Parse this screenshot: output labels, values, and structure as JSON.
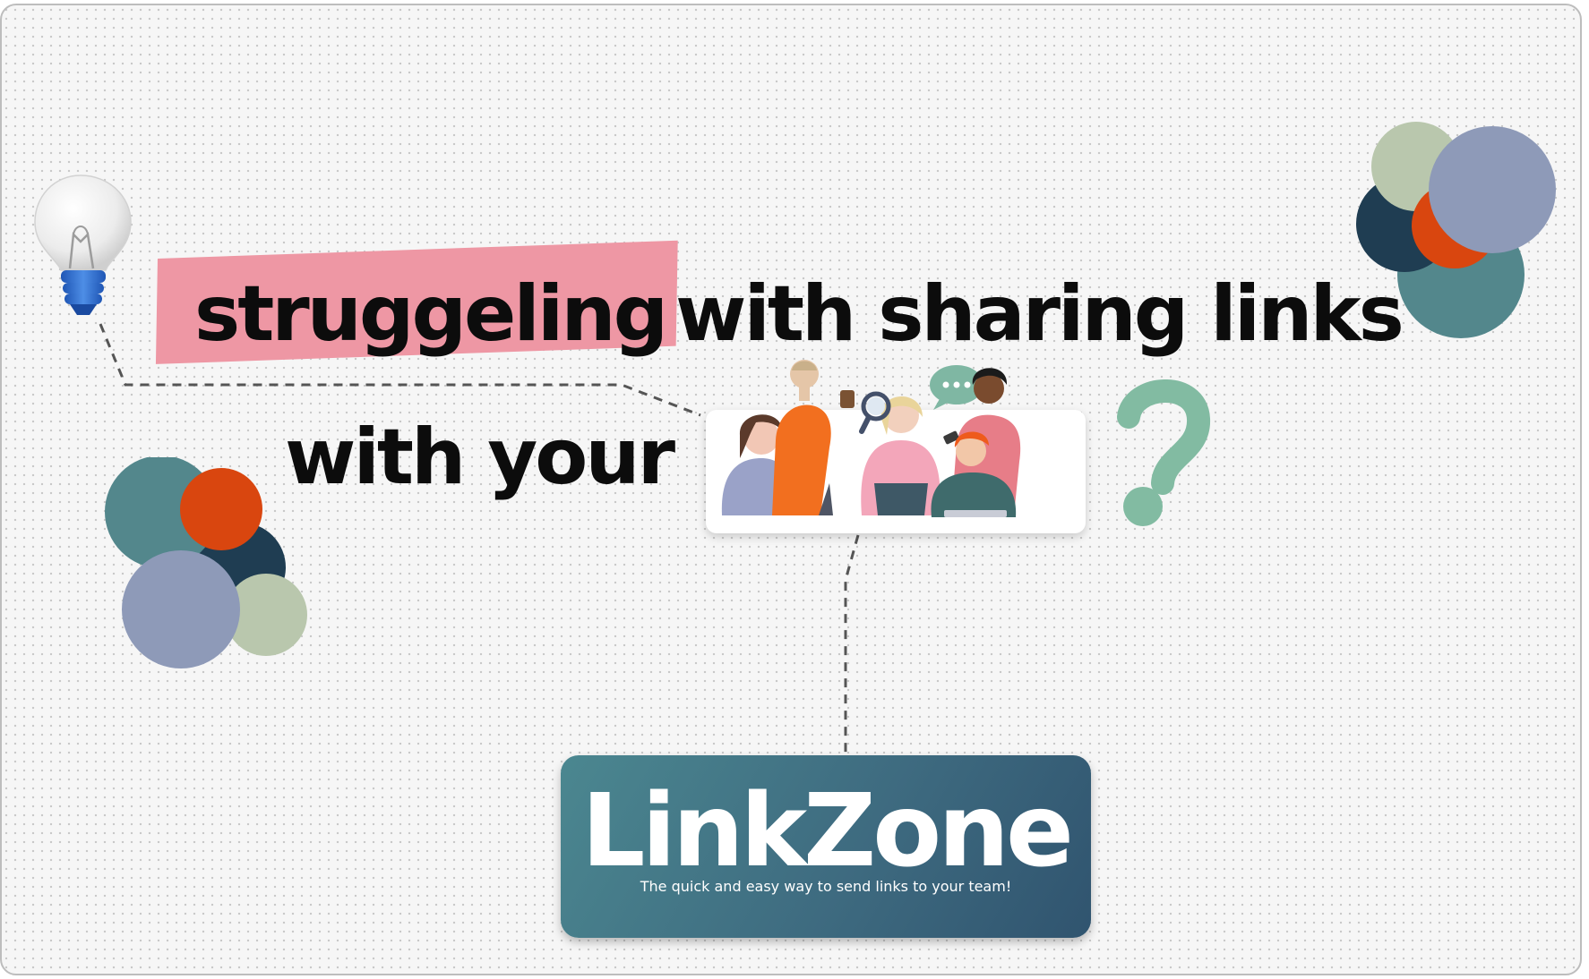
{
  "headline": {
    "highlighted": "struggeling",
    "rest_line1": "with sharing links",
    "line2": "with your"
  },
  "logo": {
    "name": "LinkZone",
    "tagline": "The quick and easy way to send links to your team!"
  },
  "icons": [
    "lightbulb-icon",
    "question-mark-icon",
    "team-illustration"
  ],
  "colors": {
    "highlight": "#ee97a4",
    "headline_text": "#0c0c0c",
    "logo_card_start": "#4b8790",
    "logo_card_end": "#30546f",
    "question_mark": "#82bba2",
    "circle_teal": "#53878c",
    "circle_orange": "#d9460f",
    "circle_navy": "#1f3d52",
    "circle_lavender": "#8e9ab8",
    "circle_sage": "#b9c7ad"
  }
}
